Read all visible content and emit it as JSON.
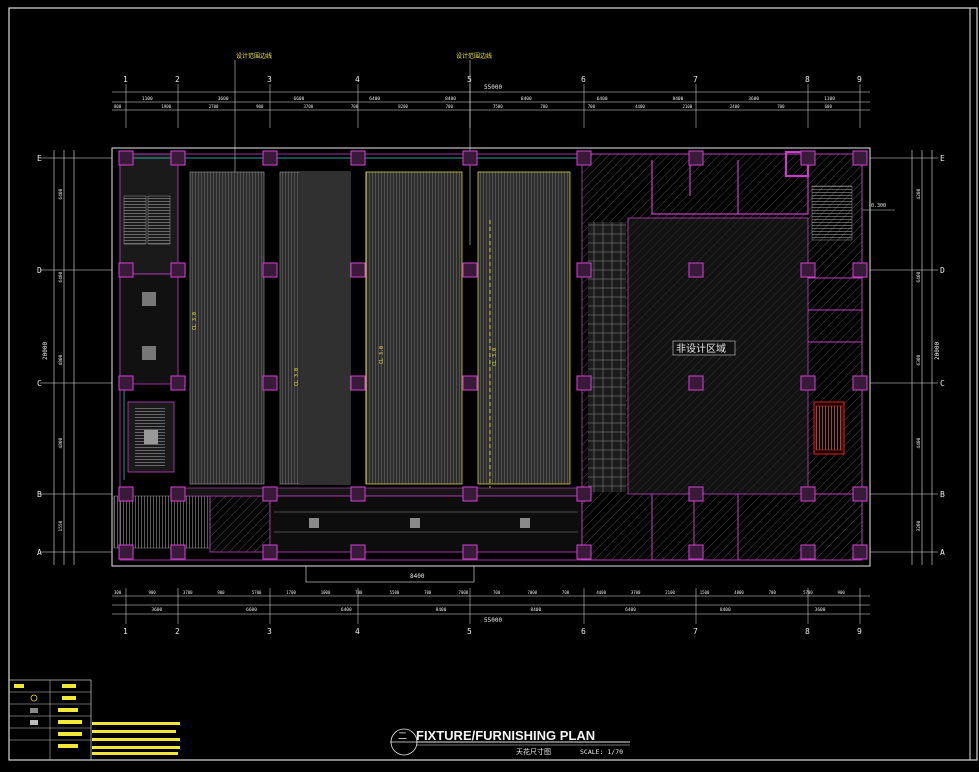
{
  "drawing": {
    "title": "FIXTURE/FURNISHING PLAN",
    "subtitle": "天花尺寸图",
    "scale": "SCALE: 1/70",
    "sheet_mark": "二",
    "area_label": "非设计区域",
    "note_top_left": "设计范围边线",
    "note_top_right": "设计范围边线",
    "total_width_top": "55000",
    "total_width_bottom": "55000",
    "total_height_left": "20000",
    "total_height_right": "20000",
    "elevation_right": "-0.300",
    "bottom_span": "8400"
  },
  "grid": {
    "columns": [
      "1",
      "2",
      "3",
      "4",
      "5",
      "6",
      "7",
      "8",
      "9"
    ],
    "rows": [
      "E",
      "D",
      "C",
      "B",
      "A"
    ]
  },
  "dims": {
    "top_main": [
      "1100",
      "3600",
      "6600",
      "6400",
      "8400",
      "8400",
      "6400",
      "8400",
      "3600",
      "1100"
    ],
    "top_sub": [
      "800",
      "1900",
      "2700",
      "900",
      "3700",
      "700",
      "8200",
      "700",
      "7500",
      "700",
      "700",
      "4400",
      "2100",
      "2400",
      "700",
      "600"
    ],
    "bottom_main": [
      "3600",
      "6600",
      "6400",
      "8400",
      "8400",
      "6400",
      "8400",
      "3600"
    ],
    "bottom_sub": [
      "300",
      "900",
      "3700",
      "900",
      "5700",
      "1700",
      "1000",
      "700",
      "5500",
      "700",
      "7000",
      "700",
      "7000",
      "700",
      "4400",
      "3700",
      "2100",
      "1500",
      "4000",
      "700",
      "5700",
      "900"
    ],
    "left_main": [
      "6400",
      "6400",
      "4800",
      "4800",
      "1550"
    ],
    "right_main": [
      "4200",
      "6400",
      "6300",
      "4400",
      "3200"
    ]
  },
  "colors": {
    "wall": "#c43fc4",
    "dim": "#e8e8e8",
    "highlight": "#f1e63a",
    "hatch": "#5a5a5a",
    "fill": "#2a2a2a",
    "stair_red": "#e02020",
    "cyan": "#3ad1d1"
  }
}
